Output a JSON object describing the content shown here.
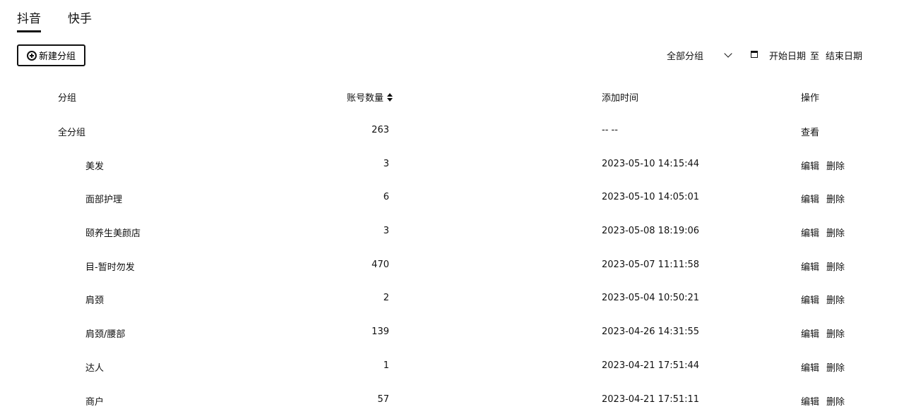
{
  "tabs": [
    {
      "label": "抖音",
      "active": true
    },
    {
      "label": "快手",
      "active": false
    }
  ],
  "toolbar": {
    "new_group_label": "新建分组",
    "group_filter_value": "全部分组",
    "date_start_placeholder": "开始日期",
    "date_separator": "至",
    "date_end_placeholder": "结束日期"
  },
  "table": {
    "headers": {
      "group": "分组",
      "account_count": "账号数量",
      "added_time": "添加时间",
      "actions": "操作"
    },
    "rows": [
      {
        "name": "全分组",
        "count": "263",
        "time": "-- --",
        "ops": [
          "查看"
        ]
      },
      {
        "name": "美发",
        "count": "3",
        "time": "2023-05-10 14:15:44",
        "ops": [
          "编辑",
          "删除"
        ]
      },
      {
        "name": "面部护理",
        "count": "6",
        "time": "2023-05-10 14:05:01",
        "ops": [
          "编辑",
          "删除"
        ]
      },
      {
        "name": "颐养生美颜店",
        "count": "3",
        "time": "2023-05-08 18:19:06",
        "ops": [
          "编辑",
          "删除"
        ]
      },
      {
        "name": "目-暂时勿发",
        "count": "470",
        "time": "2023-05-07 11:11:58",
        "ops": [
          "编辑",
          "删除"
        ]
      },
      {
        "name": "肩颈",
        "count": "2",
        "time": "2023-05-04 10:50:21",
        "ops": [
          "编辑",
          "删除"
        ]
      },
      {
        "name": "肩颈/腰部",
        "count": "139",
        "time": "2023-04-26 14:31:55",
        "ops": [
          "编辑",
          "删除"
        ]
      },
      {
        "name": "达人",
        "count": "1",
        "time": "2023-04-21 17:51:44",
        "ops": [
          "编辑",
          "删除"
        ]
      },
      {
        "name": "商户",
        "count": "57",
        "time": "2023-04-21 17:51:11",
        "ops": [
          "编辑",
          "删除"
        ]
      }
    ]
  }
}
